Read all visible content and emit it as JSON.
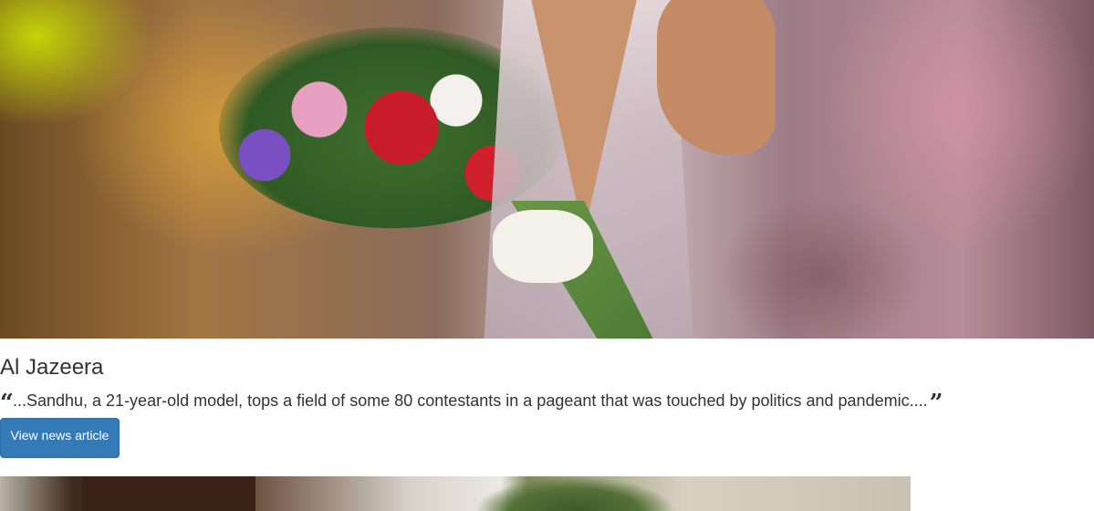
{
  "hero_image": {
    "alt": "Miss Universe winner holding a bouquet of flowers"
  },
  "article": {
    "source": "Al Jazeera",
    "quote": "...Sandhu, a 21-year-old model, tops a field of some 80 contestants in a pageant that was touched by politics and pandemic....",
    "button_label": "View news article",
    "open_quote_icon": "quote-left-icon",
    "close_quote_icon": "quote-right-icon"
  },
  "colors": {
    "button_bg": "#337ab7",
    "text": "#333333"
  }
}
